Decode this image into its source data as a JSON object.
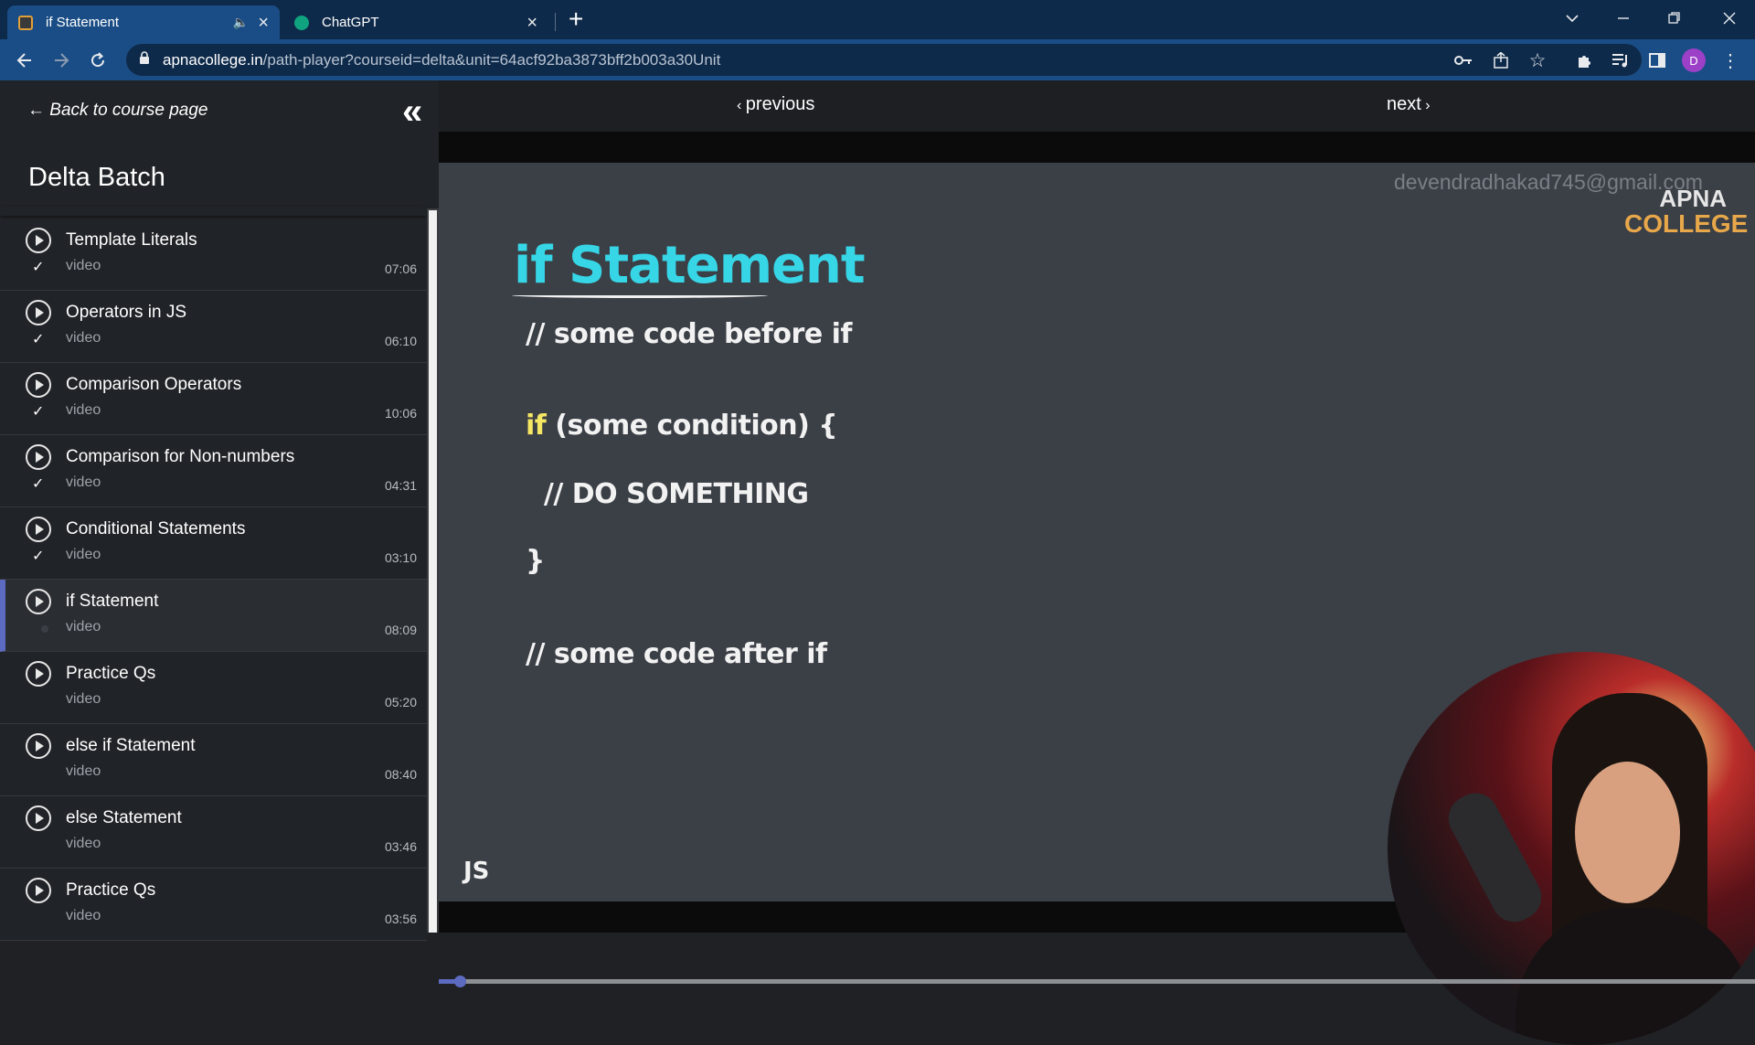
{
  "browser": {
    "tabs": [
      {
        "title": "if Statement",
        "active": true
      },
      {
        "title": "ChatGPT",
        "active": false
      }
    ],
    "url_host": "apnacollege.in",
    "url_path": "/path-player?courseid=delta&unit=64acf92ba3873bff2b003a30Unit",
    "profile_initial": "D"
  },
  "sidebar": {
    "back_label": "Back to course page",
    "course_title": "Delta Batch",
    "lessons": [
      {
        "title": "Template Literals",
        "type": "video",
        "duration": "07:06",
        "completed": true
      },
      {
        "title": "Operators in JS",
        "type": "video",
        "duration": "06:10",
        "completed": true
      },
      {
        "title": "Comparison Operators",
        "type": "video",
        "duration": "10:06",
        "completed": true
      },
      {
        "title": "Comparison for Non-numbers",
        "type": "video",
        "duration": "04:31",
        "completed": true
      },
      {
        "title": "Conditional Statements",
        "type": "video",
        "duration": "03:10",
        "completed": true
      },
      {
        "title": "if Statement",
        "type": "video",
        "duration": "08:09",
        "completed": false,
        "current": true
      },
      {
        "title": "Practice Qs",
        "type": "video",
        "duration": "05:20",
        "completed": false
      },
      {
        "title": "else if Statement",
        "type": "video",
        "duration": "08:40",
        "completed": false
      },
      {
        "title": "else Statement",
        "type": "video",
        "duration": "03:46",
        "completed": false
      },
      {
        "title": "Practice Qs",
        "type": "video",
        "duration": "03:56",
        "completed": false
      }
    ]
  },
  "player": {
    "previous_label": "previous",
    "next_label": "next",
    "watermark": "devendradhakad745@gmail.com",
    "logo_line1": "APNA",
    "logo_line2": "COLLEGE",
    "slide_title": "if Statement",
    "code": {
      "line1": "// some code before if",
      "line2_kw": "if",
      "line2_rest": " (some condition) {",
      "line3": "  // DO SOMETHING",
      "line4": "}",
      "line5": "// some code after if"
    },
    "lang_label": "JS",
    "progress_fraction": 0.016
  },
  "colors": {
    "accent": "#5c6bc0",
    "slide_title": "#36d6e7",
    "keyword": "#f5e663",
    "logo_college": "#e8a84a"
  }
}
